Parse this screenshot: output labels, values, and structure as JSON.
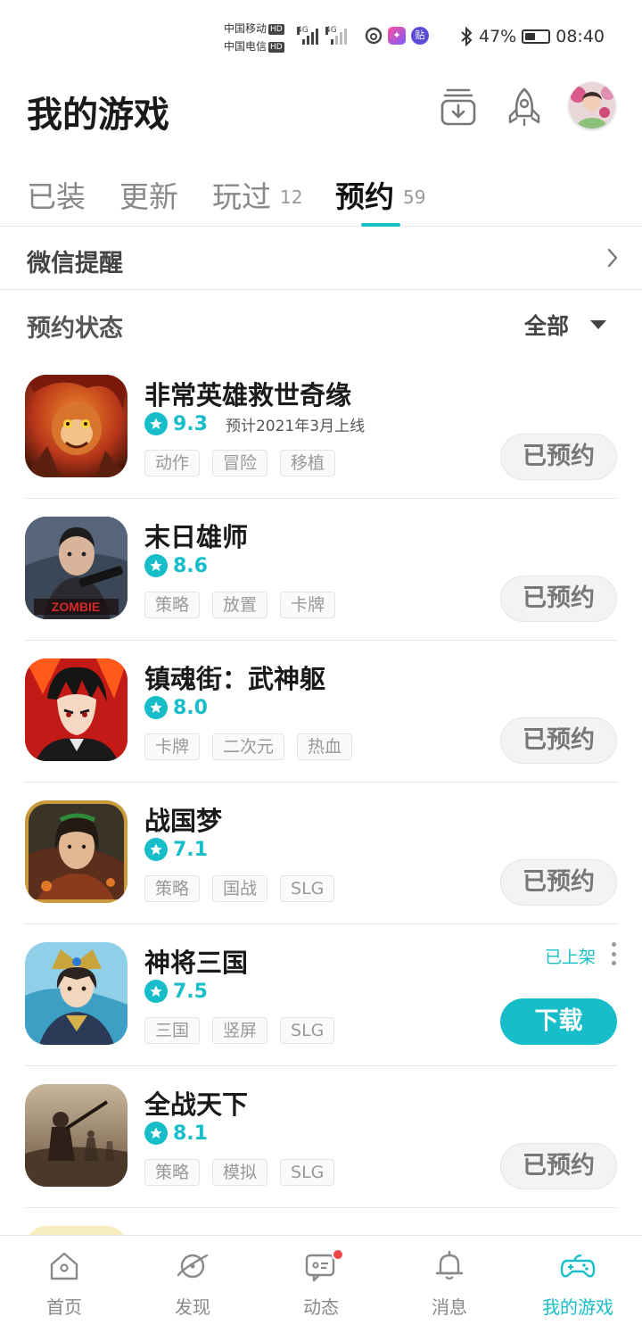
{
  "status_bar": {
    "carrier_1": "中国移动",
    "carrier_2": "中国电信",
    "hd_badge": "HD",
    "network_1": "4G",
    "network_2": "4G",
    "battery_percent": "47%",
    "battery_level": 0.47,
    "time": "08:40",
    "app_badge_1": "贴"
  },
  "header": {
    "title": "我的游戏"
  },
  "tabs": [
    {
      "label": "已装",
      "count": ""
    },
    {
      "label": "更新",
      "count": ""
    },
    {
      "label": "玩过",
      "count": "12"
    },
    {
      "label": "预约",
      "count": "59"
    }
  ],
  "active_tab": "预约",
  "wechat": {
    "label": "微信提醒"
  },
  "filter": {
    "label": "预约状态",
    "value": "全部"
  },
  "colors": {
    "accent": "#17bec9",
    "reserved_button_bg": "#f1f3f4",
    "notification_dot": "#f04848"
  },
  "games": [
    {
      "name": "非常英雄救世奇缘",
      "rating": "9.3",
      "release": "预计2021年3月上线",
      "tags": [
        "动作",
        "冒险",
        "移植"
      ],
      "button": "已预约",
      "status": ""
    },
    {
      "name": "末日雄师",
      "rating": "8.6",
      "release": "",
      "tags": [
        "策略",
        "放置",
        "卡牌"
      ],
      "button": "已预约",
      "status": ""
    },
    {
      "name": "镇魂街：武神躯",
      "rating": "8.0",
      "release": "",
      "tags": [
        "卡牌",
        "二次元",
        "热血"
      ],
      "button": "已预约",
      "status": ""
    },
    {
      "name": "战国梦",
      "rating": "7.1",
      "release": "",
      "tags": [
        "策略",
        "国战",
        "SLG"
      ],
      "button": "已预约",
      "status": ""
    },
    {
      "name": "神将三国",
      "rating": "7.5",
      "release": "",
      "tags": [
        "三国",
        "竖屏",
        "SLG"
      ],
      "button": "下载",
      "status": "已上架"
    },
    {
      "name": "全战天下",
      "rating": "8.1",
      "release": "",
      "tags": [
        "策略",
        "模拟",
        "SLG"
      ],
      "button": "已预约",
      "status": ""
    }
  ],
  "bottom_nav": [
    {
      "label": "首页",
      "icon": "home-icon"
    },
    {
      "label": "发现",
      "icon": "planet-icon"
    },
    {
      "label": "动态",
      "icon": "chat-icon"
    },
    {
      "label": "消息",
      "icon": "bell-icon"
    },
    {
      "label": "我的游戏",
      "icon": "gamepad-icon"
    }
  ]
}
